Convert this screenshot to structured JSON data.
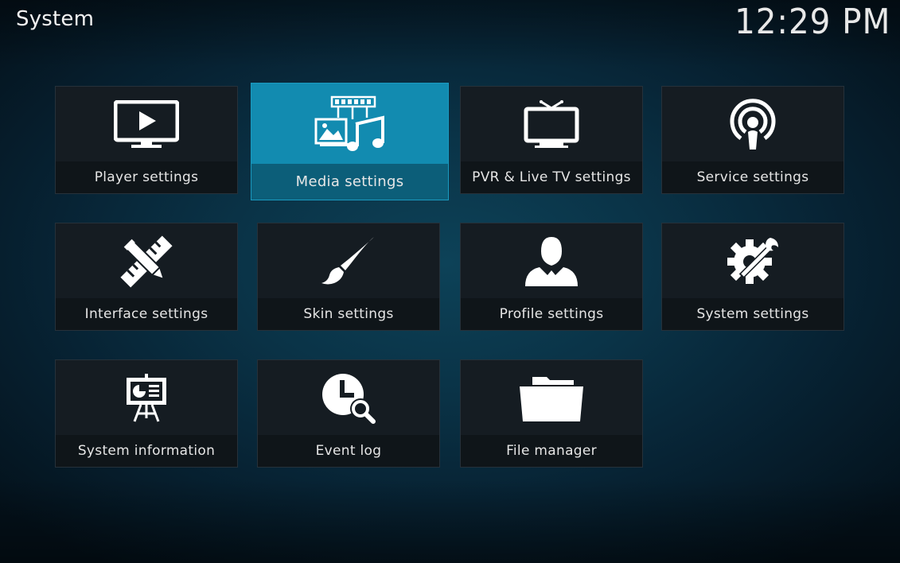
{
  "header": {
    "title": "System",
    "clock": "12:29 PM"
  },
  "tiles": [
    {
      "label": "Player settings",
      "icon": "play-monitor-icon"
    },
    {
      "label": "Media settings",
      "icon": "media-icon"
    },
    {
      "label": "PVR & Live TV settings",
      "icon": "tv-icon"
    },
    {
      "label": "Service settings",
      "icon": "podcast-icon"
    },
    {
      "label": "Interface settings",
      "icon": "pencil-ruler-icon"
    },
    {
      "label": "Skin settings",
      "icon": "paintbrush-icon"
    },
    {
      "label": "Profile settings",
      "icon": "profile-icon"
    },
    {
      "label": "System settings",
      "icon": "gear-wrench-icon"
    },
    {
      "label": "System information",
      "icon": "presentation-icon"
    },
    {
      "label": "Event log",
      "icon": "clock-search-icon"
    },
    {
      "label": "File manager",
      "icon": "folder-icon"
    }
  ],
  "colors": {
    "focus": "#128bb0",
    "tile": "#151c22"
  }
}
